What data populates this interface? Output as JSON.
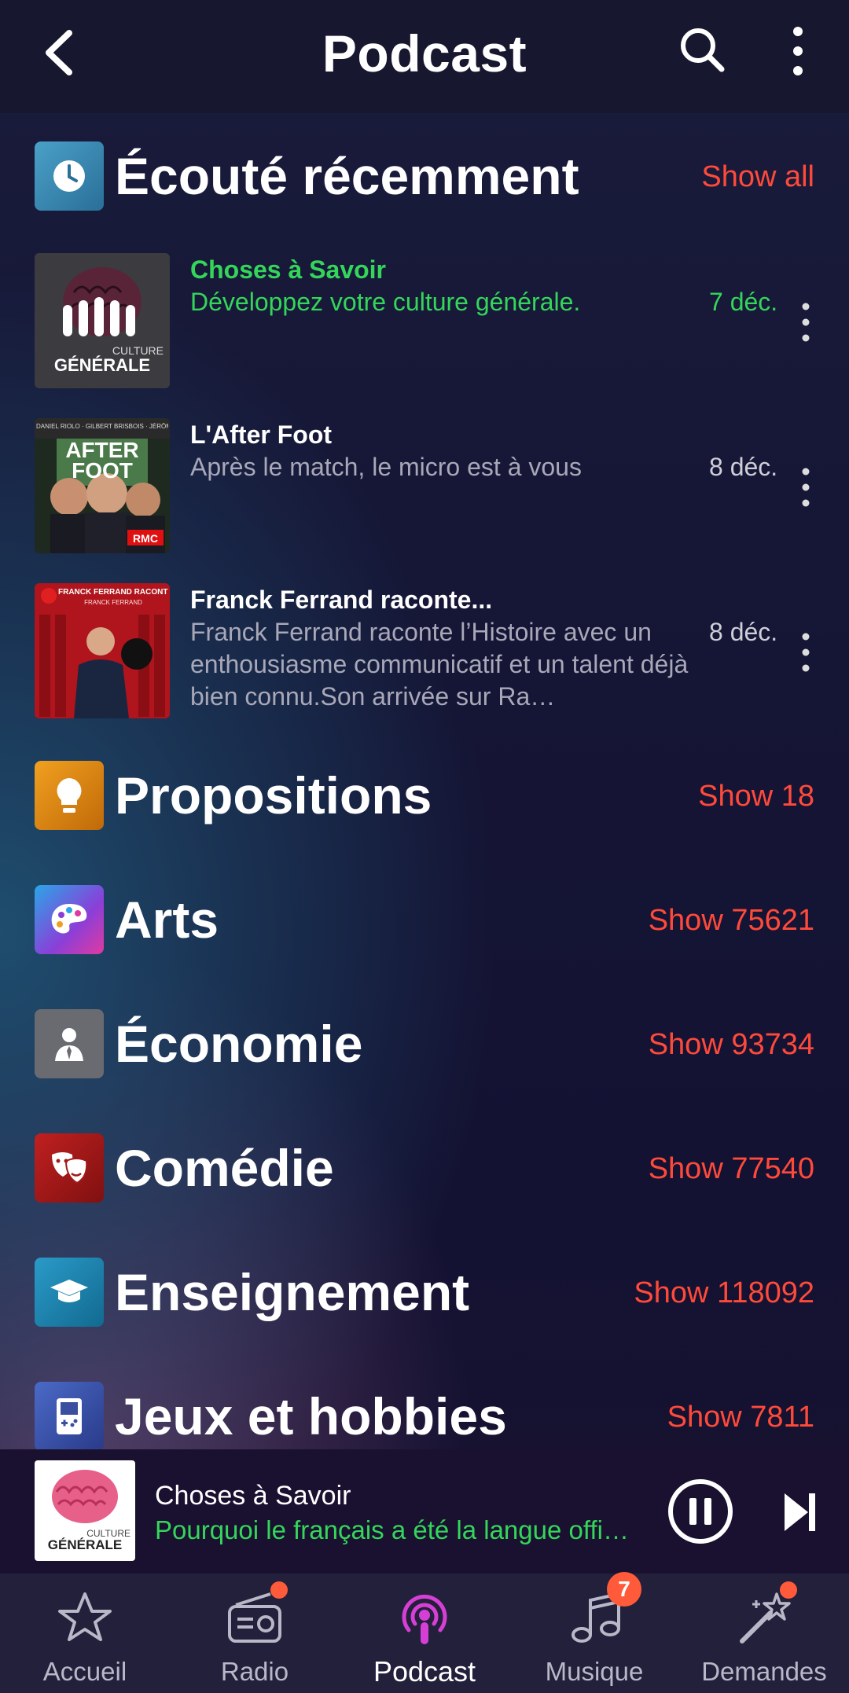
{
  "header": {
    "title": "Podcast"
  },
  "recent": {
    "title": "Écouté récemment",
    "action": "Show all",
    "episodes": [
      {
        "title": "Choses à Savoir",
        "description": "Développez votre culture générale.",
        "date": "7 déc.",
        "art_top": "",
        "art_label": "CULTURE",
        "art_label2": "GÉNÉRALE",
        "playing": true
      },
      {
        "title": "L'After Foot",
        "description": "Après le match, le micro est à vous",
        "date": "8 déc.",
        "art_top": "DANIEL RIOLO · GILBERT BRISBOIS · JÉRÔME ROTHEN",
        "art_label": "AFTER FOOT",
        "art_label2": "RMC"
      },
      {
        "title": "Franck Ferrand raconte...",
        "description": "Franck Ferrand raconte l’Histoire avec un enthousiasme communicatif et un talent déjà bien connu.Son arrivée sur Ra…",
        "date": "8 déc.",
        "art_top": "FRANCK FERRAND RACONTE",
        "art_label": "FRANCK FERRAND",
        "art_label2": ""
      }
    ]
  },
  "categories": [
    {
      "title": "Propositions",
      "action": "Show 18",
      "icon": "lightbulb-icon",
      "color": "#e08a12"
    },
    {
      "title": "Arts",
      "action": "Show 75621",
      "icon": "palette-icon",
      "color": "#7a4bdc"
    },
    {
      "title": "Économie",
      "action": "Show 93734",
      "icon": "businessman-icon",
      "color": "#6a6a72"
    },
    {
      "title": "Comédie",
      "action": "Show 77540",
      "icon": "theater-masks-icon",
      "color": "#a41818"
    },
    {
      "title": "Enseignement",
      "action": "Show 118092",
      "icon": "graduation-cap-icon",
      "color": "#1a7fa8"
    },
    {
      "title": "Jeux et hobbies",
      "action": "Show 7811",
      "icon": "gameboy-icon",
      "color": "#3a4fa0"
    }
  ],
  "now_playing": {
    "title": "Choses à Savoir",
    "subtitle": "Pourquoi le français a été la langue offi…",
    "art_label": "CULTURE",
    "art_label2": "GÉNÉRALE"
  },
  "bottom_nav": [
    {
      "label": "Accueil",
      "icon": "star-icon",
      "active": false
    },
    {
      "label": "Radio",
      "icon": "radio-icon",
      "active": false,
      "dot": true
    },
    {
      "label": "Podcast",
      "icon": "podcast-icon",
      "active": true
    },
    {
      "label": "Musique",
      "icon": "music-note-icon",
      "active": false,
      "badge": "7"
    },
    {
      "label": "Demandes",
      "icon": "magic-wand-icon",
      "active": false,
      "dot": true
    }
  ],
  "colors": {
    "accent": "#ff4a3a",
    "playing_green": "#34d65a",
    "active_nav": "#d63fd6"
  }
}
